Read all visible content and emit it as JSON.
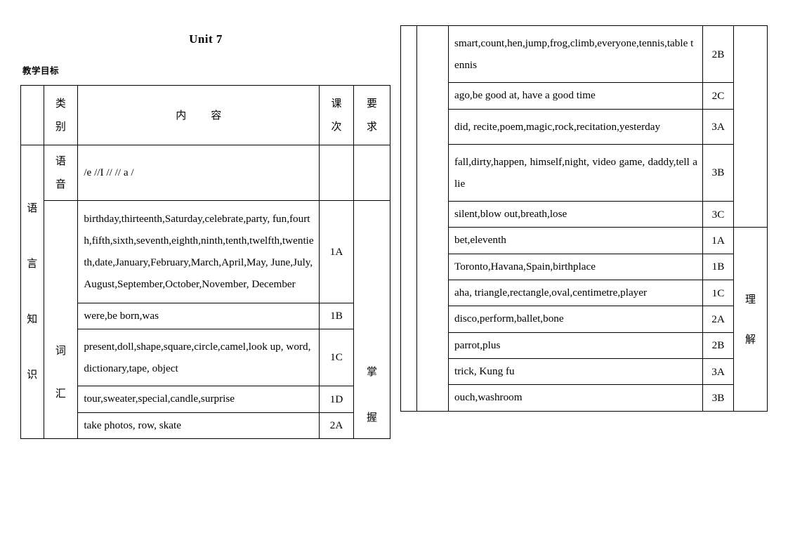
{
  "page": {
    "title": "Unit 7",
    "section_heading": "教学目标"
  },
  "table_headers": {
    "col1": "",
    "col2": "类别",
    "col2_line1": "类",
    "col2_line2": "别",
    "content": "内　容",
    "lesson": "课次",
    "lesson_line1": "课",
    "lesson_line2": "次",
    "requirement": "要求",
    "requirement_line1": "要",
    "requirement_line2": "求"
  },
  "labels": {
    "category_knowledge": "语言知识",
    "category_knowledge_chars": [
      "语",
      "言",
      "知",
      "识"
    ],
    "type_phonetics_chars": [
      "语",
      "音"
    ],
    "type_vocabulary_chars": [
      "词",
      "汇"
    ],
    "req_master_chars": [
      "掌",
      "握"
    ],
    "req_understand_chars": [
      "理",
      "解"
    ]
  },
  "left_table": {
    "phonetics_row": {
      "content": "/e  //I  //      // a   /",
      "lesson": "",
      "requirement": ""
    },
    "vocab_rows": [
      {
        "content": "birthday,thirteenth,Saturday,celebrate,party, fun,fourth,fifth,sixth,seventh,eighth,ninth,tenth,twelfth,twentieth,date,January,February,March,April,May, June,July,August,September,October,November, December",
        "lesson": "1A"
      },
      {
        "content": "were,be born,was",
        "lesson": "1B"
      },
      {
        "content": "present,doll,shape,square,circle,camel,look up, word, dictionary,tape, object",
        "lesson": "1C"
      },
      {
        "content": "tour,sweater,special,candle,surprise",
        "lesson": "1D"
      },
      {
        "content": "take photos, row, skate",
        "lesson": "2A"
      }
    ]
  },
  "right_table": {
    "master_rows": [
      {
        "content": "smart,count,hen,jump,frog,climb,everyone,tennis,table tennis",
        "lesson": "2B"
      },
      {
        "content": "ago,be good at, have a good time",
        "lesson": "2C"
      },
      {
        "content": "did, recite,poem,magic,rock,recitation,yesterday",
        "lesson": "3A"
      },
      {
        "content": "fall,dirty,happen, himself,night, video game, daddy,tell a lie",
        "lesson": "3B"
      },
      {
        "content": "silent,blow out,breath,lose",
        "lesson": "3C"
      }
    ],
    "understand_rows": [
      {
        "content": "bet,eleventh",
        "lesson": "1A"
      },
      {
        "content": "Toronto,Havana,Spain,birthplace",
        "lesson": "1B"
      },
      {
        "content": "aha, triangle,rectangle,oval,centimetre,player",
        "lesson": "1C"
      },
      {
        "content": "disco,perform,ballet,bone",
        "lesson": "2A"
      },
      {
        "content": "parrot,plus",
        "lesson": "2B"
      },
      {
        "content": "trick, Kung fu",
        "lesson": "3A"
      },
      {
        "content": "ouch,washroom",
        "lesson": "3B"
      }
    ]
  },
  "colors": {
    "text": "#000000",
    "border": "#000000",
    "background": "#ffffff"
  }
}
